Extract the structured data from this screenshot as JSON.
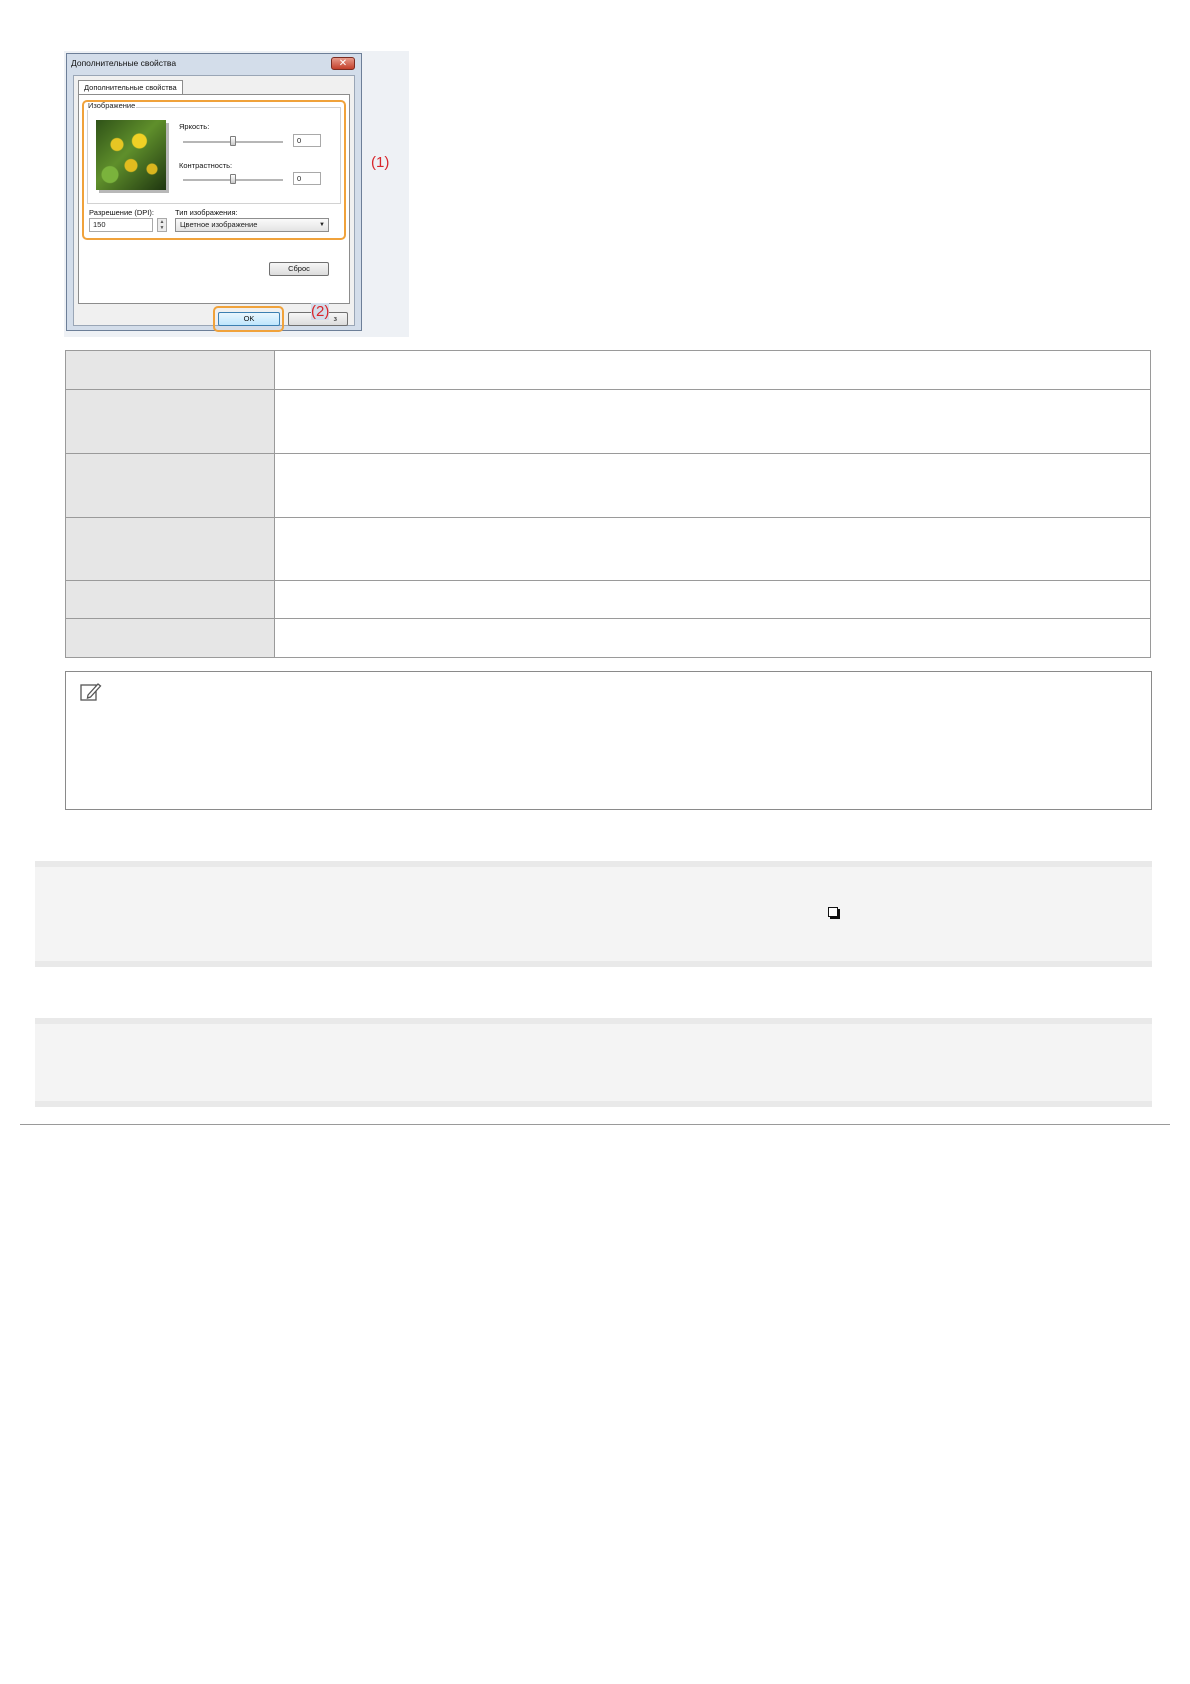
{
  "dialog": {
    "title": "Дополнительные свойства",
    "close_glyph": "✕",
    "tab_label": "Дополнительные свойства",
    "group_label": "Изображение",
    "brightness_label": "Яркость:",
    "brightness_value": "0",
    "contrast_label": "Контрастность:",
    "contrast_value": "0",
    "resolution_label": "Разрешение (DPI):",
    "resolution_value": "150",
    "image_type_label": "Тип изображения:",
    "image_type_value": "Цветное изображение",
    "reset_button": "Сброс",
    "ok_button": "OK",
    "cancel_button_partial": "з"
  },
  "callouts": {
    "one": "(1)",
    "two": "(2)"
  },
  "table_rows": 6,
  "icons": {
    "note": "note-pencil-icon",
    "checkbox": "checkbox-icon"
  },
  "colors": {
    "highlight": "#f0a23b",
    "callout": "#d8262c",
    "header_cell": "#e6e6e6"
  }
}
